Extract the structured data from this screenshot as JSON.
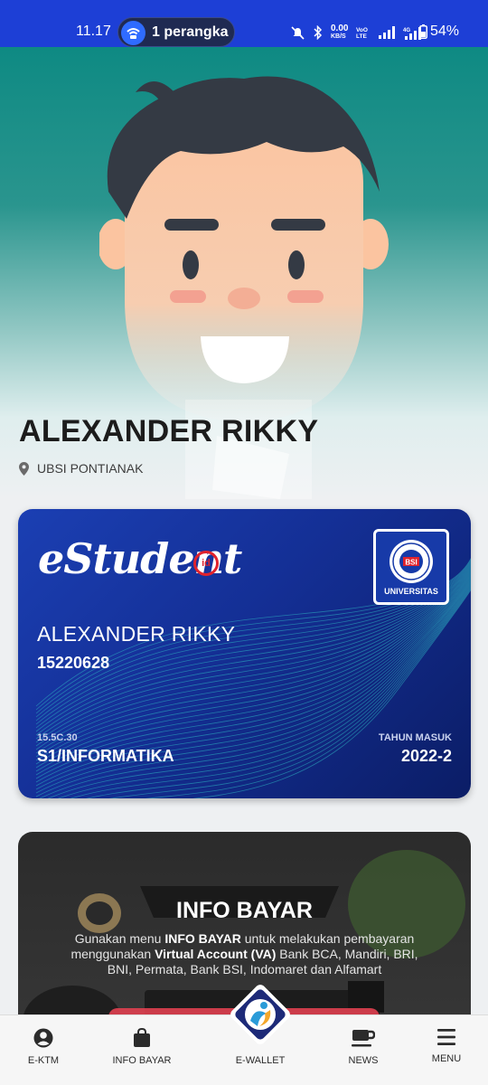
{
  "status_bar": {
    "time": "11.17",
    "hotspot_text": "1 perangka",
    "data_speed": "0.00",
    "data_unit": "KB/S",
    "battery": "54%"
  },
  "profile": {
    "name": "ALEXANDER RIKKY",
    "campus": "UBSI PONTIANAK"
  },
  "student_card": {
    "logo_text": "eStudent",
    "logo_suffix": "id",
    "university_label": "UNIVERSITAS",
    "name": "ALEXANDER RIKKY",
    "nim": "15220628",
    "class_code": "15.5C.30",
    "program": "S1/INFORMATIKA",
    "year_label": "TAHUN MASUK",
    "year": "2022-2"
  },
  "info_bayar": {
    "title": "INFO BAYAR",
    "desc_1": "Gunakan menu ",
    "desc_bold_1": "INFO BAYAR",
    "desc_2": " untuk melakukan pembayaran menggunakan ",
    "desc_bold_2": "Virtual Account (VA)",
    "desc_3": " Bank BCA, Mandiri, BRI, BNI, Permata, Bank BSI, Indomaret dan Alfamart"
  },
  "bottom_nav": {
    "ektm": "E-KTM",
    "info_bayar": "INFO BAYAR",
    "ewallet": "E-WALLET",
    "news": "NEWS",
    "menu": "MENU"
  },
  "colors": {
    "status_bar": "#1d3fd6",
    "hero_teal": "#0e8a83",
    "card_blue": "#142f95",
    "card_wave": "#2fb8c4",
    "brand_red": "#e0232d"
  }
}
